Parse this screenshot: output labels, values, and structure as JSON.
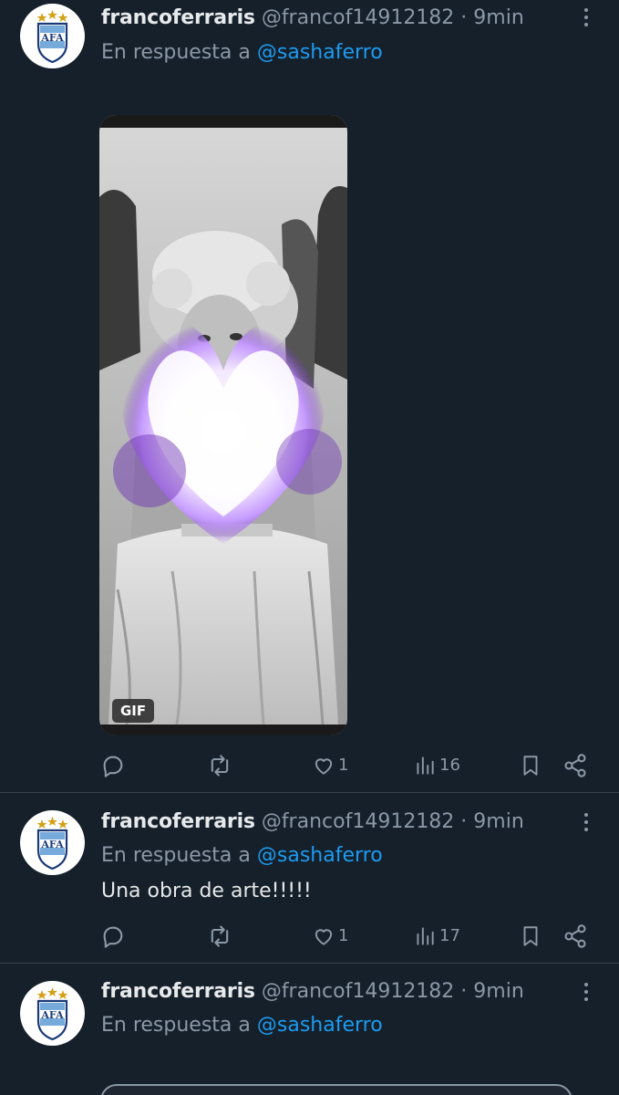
{
  "tweets": [
    {
      "name": "francoferraris",
      "meta": "@francof14912182 · 9min",
      "reply_prefix": "En respuesta a",
      "reply_handle": "@sashaferro",
      "media_badge": "GIF",
      "likes": "1",
      "views": "16"
    },
    {
      "name": "francoferraris",
      "meta": "@francof14912182 · 9min",
      "reply_prefix": "En respuesta a",
      "reply_handle": "@sashaferro",
      "text": "Una obra de arte!!!!!",
      "likes": "1",
      "views": "17"
    },
    {
      "name": "francoferraris",
      "meta": "@francof14912182 · 9min",
      "reply_prefix": "En respuesta a",
      "reply_handle": "@sashaferro"
    }
  ],
  "avatar_letters": "AFA",
  "colors": {
    "background": "#15202b",
    "text": "#e7e9ea",
    "muted": "#8b98a5",
    "link": "#1d9bf0",
    "divider": "#38444d"
  },
  "icons": [
    "reply-icon",
    "retweet-icon",
    "like-icon",
    "views-icon",
    "bookmark-icon",
    "share-icon",
    "more-icon"
  ]
}
